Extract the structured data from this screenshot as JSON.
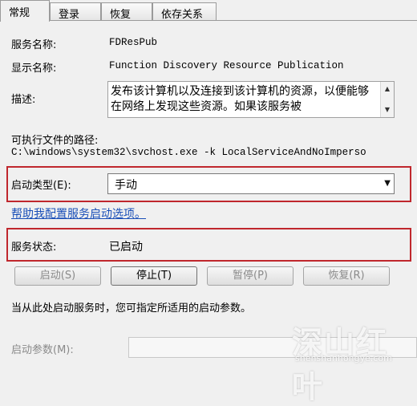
{
  "tabs": [
    {
      "label": "常规",
      "active": true
    },
    {
      "label": "登录",
      "active": false
    },
    {
      "label": "恢复",
      "active": false
    },
    {
      "label": "依存关系",
      "active": false
    }
  ],
  "service_name": {
    "label": "服务名称:",
    "value": "FDResPub"
  },
  "display_name": {
    "label": "显示名称:",
    "value": "Function Discovery Resource Publication"
  },
  "description": {
    "label": "描述:",
    "value": "发布该计算机以及连接到该计算机的资源，以便能够在网络上发现这些资源。如果该服务被"
  },
  "exe_path": {
    "label": "可执行文件的路径:",
    "value": "C:\\windows\\system32\\svchost.exe -k LocalServiceAndNoImperso"
  },
  "startup_type": {
    "label": "启动类型(E):",
    "value": "手动"
  },
  "help_link": "帮助我配置服务启动选项。",
  "status": {
    "label": "服务状态:",
    "value": "已启动"
  },
  "buttons": {
    "start": "启动(S)",
    "stop": "停止(T)",
    "pause": "暂停(P)",
    "resume": "恢复(R)"
  },
  "hint": "当从此处启动服务时，您可指定所适用的启动参数。",
  "start_params": {
    "label": "启动参数(M):",
    "value": ""
  },
  "watermark": {
    "main": "深山红叶",
    "sub": "shenshanhongye.com"
  },
  "colors": {
    "highlight_border": "#c0272d",
    "link": "#1a4fb8"
  }
}
